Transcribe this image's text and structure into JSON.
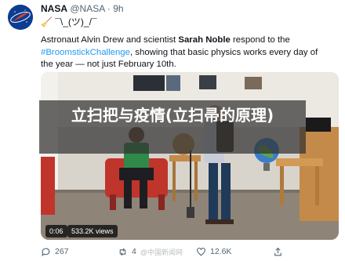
{
  "tweet": {
    "name": "NASA",
    "handle": "@NASA",
    "separator": "·",
    "time": "9h",
    "shrug": "🧹 ¯\\_(ツ)_/¯",
    "text_part1": "Astronaut Alvin Drew and scientist ",
    "text_bold": "Sarah Noble",
    "text_part2": " respond to the ",
    "hashtag": "#BroomstickChallenge",
    "text_part3": ", showing that basic physics works every day of the year — not just February 10th."
  },
  "video": {
    "duration": "0:06",
    "views": "533.2K views",
    "overlay_title": "立扫把与疫情(立扫帚的原理)"
  },
  "actions": {
    "replies": "267",
    "retweets": "4",
    "retweet_watermark": "@中国新闻网",
    "likes": "12.6K"
  },
  "colors": {
    "accent": "#1d9bf0",
    "nasa_blue": "#0b3d91",
    "nasa_red": "#fc3d21"
  },
  "icons": [
    "nasa-logo-icon",
    "reply-icon",
    "retweet-icon",
    "like-icon",
    "share-icon"
  ]
}
